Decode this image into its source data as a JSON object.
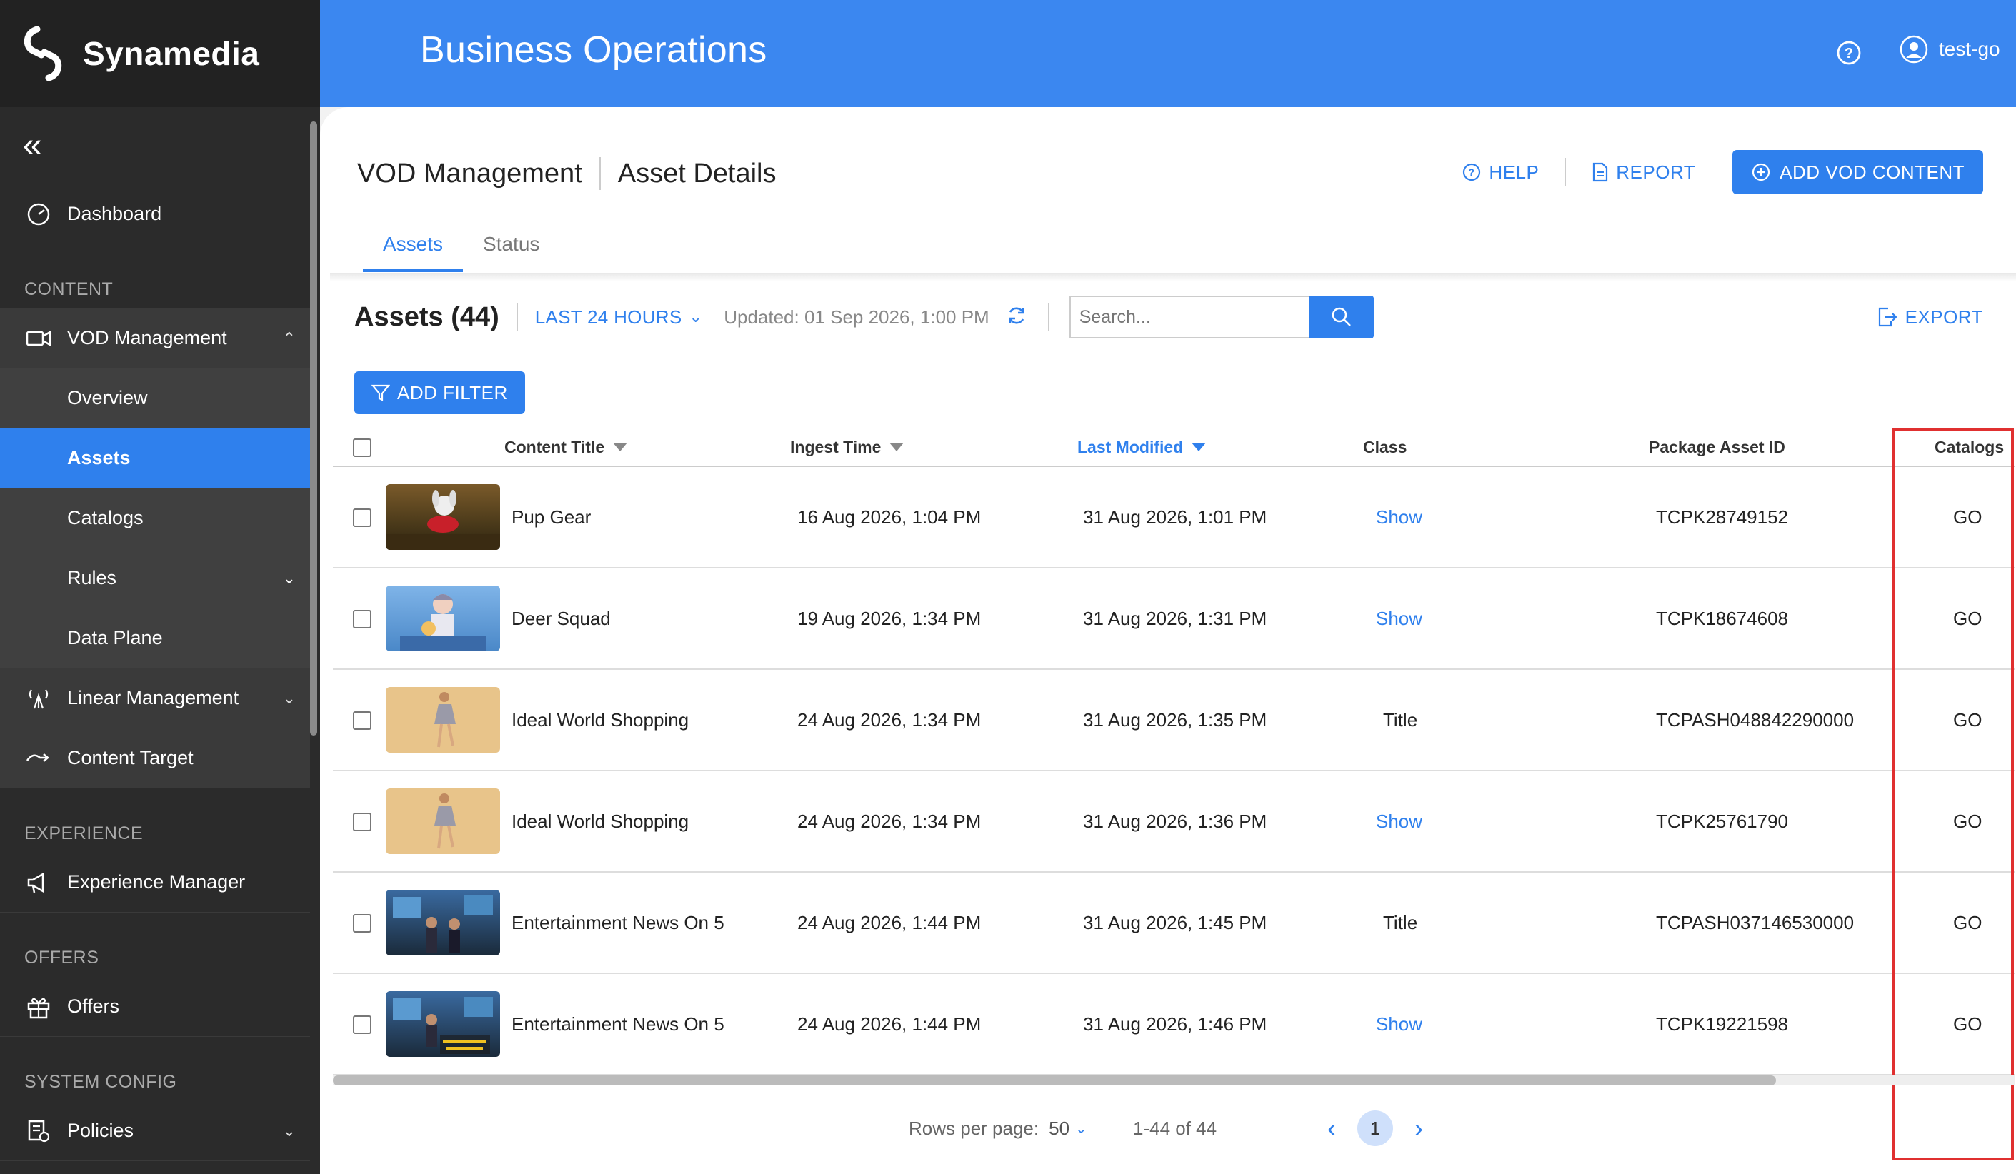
{
  "app": {
    "brand": "Synamedia",
    "title": "Business Operations",
    "user": "test-go"
  },
  "colors": {
    "accent": "#2f80ed",
    "header": "#3b87f0",
    "sidebar": "#2b2b2b",
    "highlight": "#e03030"
  },
  "sidebar": {
    "collapse_icon": "double-chevron-left-icon",
    "dashboard": "Dashboard",
    "sections": {
      "content": "CONTENT",
      "experience": "EXPERIENCE",
      "offers": "OFFERS",
      "system_config": "SYSTEM CONFIG"
    },
    "vod": "VOD Management",
    "vod_children": [
      "Overview",
      "Assets",
      "Catalogs",
      "Rules",
      "Data Plane"
    ],
    "linear": "Linear Management",
    "content_target": "Content Target",
    "experience_manager": "Experience Manager",
    "offers": "Offers",
    "policies": "Policies"
  },
  "page": {
    "breadcrumb_root": "VOD Management",
    "breadcrumb_current": "Asset Details",
    "help": "HELP",
    "report": "REPORT",
    "add_vod": "ADD VOD CONTENT",
    "tabs": [
      "Assets",
      "Status"
    ],
    "assets_title": "Assets (44)",
    "time_range": "LAST 24 HOURS",
    "updated": "Updated: 01 Sep 2026, 1:00 PM",
    "search_placeholder": "Search...",
    "export": "EXPORT",
    "add_filter": "ADD FILTER"
  },
  "table": {
    "columns": [
      "Content Title",
      "Ingest Time",
      "Last Modified",
      "Class",
      "Package Asset ID",
      "Catalogs"
    ],
    "sorted_column": "Last Modified",
    "rows": [
      {
        "title": "Pup Gear",
        "ingest": "16 Aug 2026, 1:04 PM",
        "modified": "31 Aug 2026, 1:01 PM",
        "class": "Show",
        "asset_id": "TCPK28749152",
        "catalogs": "GO"
      },
      {
        "title": "Deer Squad",
        "ingest": "19 Aug 2026, 1:34 PM",
        "modified": "31 Aug 2026, 1:31 PM",
        "class": "Show",
        "asset_id": "TCPK18674608",
        "catalogs": "GO"
      },
      {
        "title": "Ideal World Shopping",
        "ingest": "24 Aug 2026, 1:34 PM",
        "modified": "31 Aug 2026, 1:35 PM",
        "class": "Title",
        "asset_id": "TCPASH048842290000",
        "catalogs": "GO"
      },
      {
        "title": "Ideal World Shopping",
        "ingest": "24 Aug 2026, 1:34 PM",
        "modified": "31 Aug 2026, 1:36 PM",
        "class": "Show",
        "asset_id": "TCPK25761790",
        "catalogs": "GO"
      },
      {
        "title": "Entertainment News On 5",
        "ingest": "24 Aug 2026, 1:44 PM",
        "modified": "31 Aug 2026, 1:45 PM",
        "class": "Title",
        "asset_id": "TCPASH037146530000",
        "catalogs": "GO"
      },
      {
        "title": "Entertainment News On 5",
        "ingest": "24 Aug 2026, 1:44 PM",
        "modified": "31 Aug 2026, 1:46 PM",
        "class": "Show",
        "asset_id": "TCPK19221598",
        "catalogs": "GO"
      }
    ]
  },
  "pagination": {
    "rows_label": "Rows per page:",
    "rows_value": "50",
    "range": "1-44 of 44",
    "current_page": "1"
  }
}
